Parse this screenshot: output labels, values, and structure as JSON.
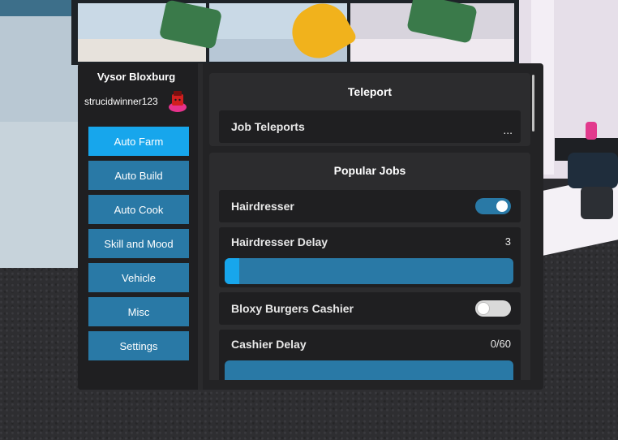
{
  "app": {
    "title": "Vysor Bloxburg",
    "username": "strucidwinner123"
  },
  "sidebar": {
    "items": [
      {
        "label": "Auto Farm",
        "active": true
      },
      {
        "label": "Auto Build",
        "active": false
      },
      {
        "label": "Auto Cook",
        "active": false
      },
      {
        "label": "Skill and Mood",
        "active": false
      },
      {
        "label": "Vehicle",
        "active": false
      },
      {
        "label": "Misc",
        "active": false
      },
      {
        "label": "Settings",
        "active": false
      }
    ]
  },
  "teleport": {
    "title": "Teleport",
    "job_teleports_label": "Job Teleports",
    "job_teleports_value": "..."
  },
  "popular_jobs": {
    "title": "Popular Jobs",
    "hairdresser": {
      "label": "Hairdresser",
      "enabled": true
    },
    "hairdresser_delay": {
      "label": "Hairdresser Delay",
      "value": "3",
      "fraction": 0.05
    },
    "bloxy_cashier": {
      "label": "Bloxy Burgers Cashier",
      "enabled": false
    },
    "cashier_delay": {
      "label": "Cashier Delay",
      "value": "0/60",
      "fraction": 0
    }
  },
  "colors": {
    "accent": "#17a6ec",
    "button": "#2979a6",
    "panel": "#232325"
  },
  "icons": {
    "avatar": "avatar-icon",
    "more": "ellipsis-icon"
  }
}
